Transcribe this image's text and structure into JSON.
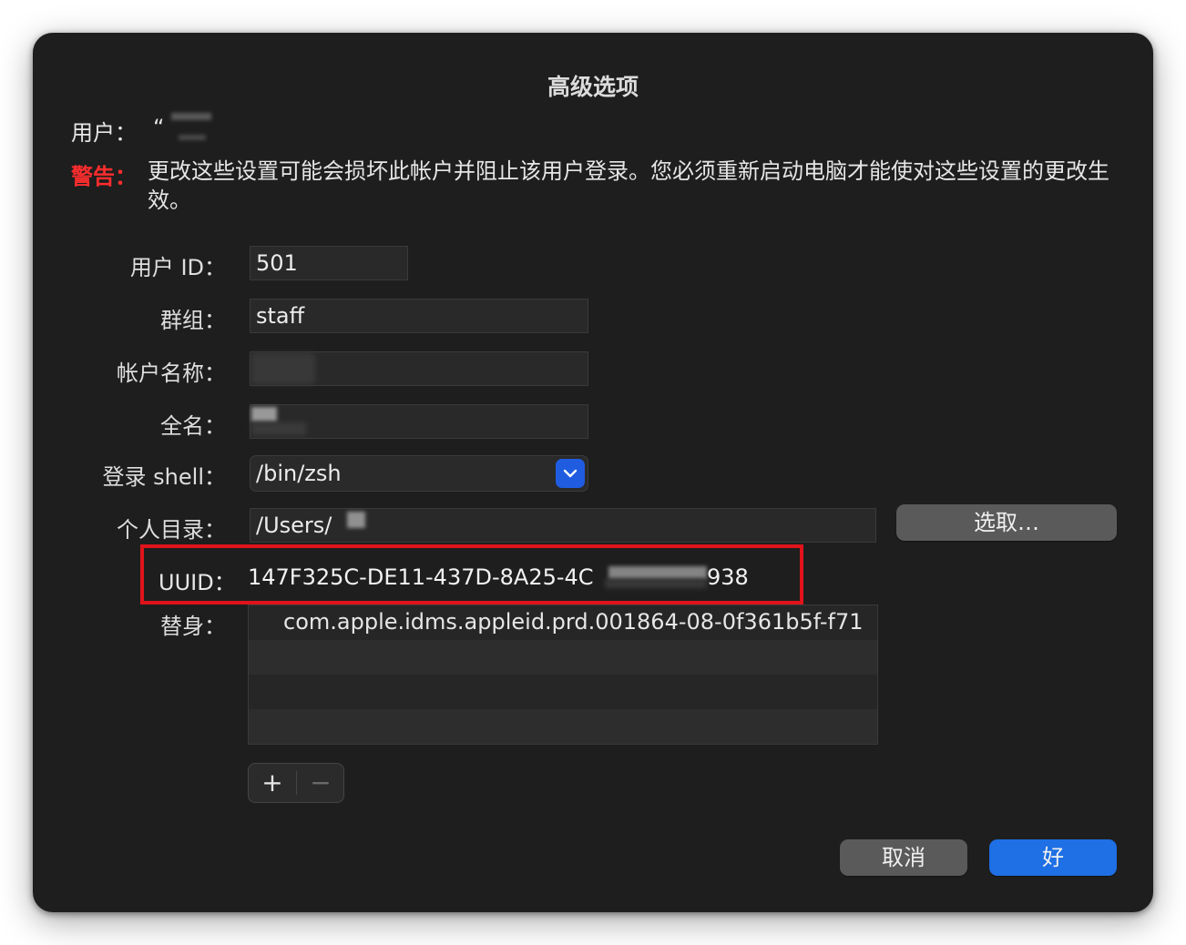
{
  "dialog": {
    "title": "高级选项",
    "user_label": "用户：",
    "user_value": "“",
    "warning_label": "警告：",
    "warning_text": "更改这些设置可能会损坏此帐户并阻止该用户登录。您必须重新启动电脑才能使对这些设置的更改生效。"
  },
  "form": {
    "user_id_label": "用户 ID：",
    "user_id_value": "501",
    "group_label": "群组：",
    "group_value": "staff",
    "account_name_label": "帐户名称：",
    "account_name_value": "",
    "full_name_label": "全名：",
    "full_name_value": "",
    "login_shell_label": "登录 shell：",
    "login_shell_value": "/bin/zsh",
    "home_dir_label": "个人目录：",
    "home_dir_value": "/Users/",
    "choose_button": "选取…",
    "uuid_label": "UUID：",
    "uuid_value_start": "147F325C-DE11-437D-8A25-4C",
    "uuid_value_end": "938",
    "aliases_label": "替身：",
    "aliases": [
      "com.apple.idms.appleid.prd.001864-08-0f361b5f-f71"
    ]
  },
  "list_controls": {
    "add_symbol": "+",
    "remove_symbol": "−"
  },
  "footer": {
    "cancel_button": "取消",
    "ok_button": "好"
  },
  "colors": {
    "warning": "#ff2d2d",
    "highlight_box": "#e0131b",
    "accent": "#1f6fe5"
  }
}
